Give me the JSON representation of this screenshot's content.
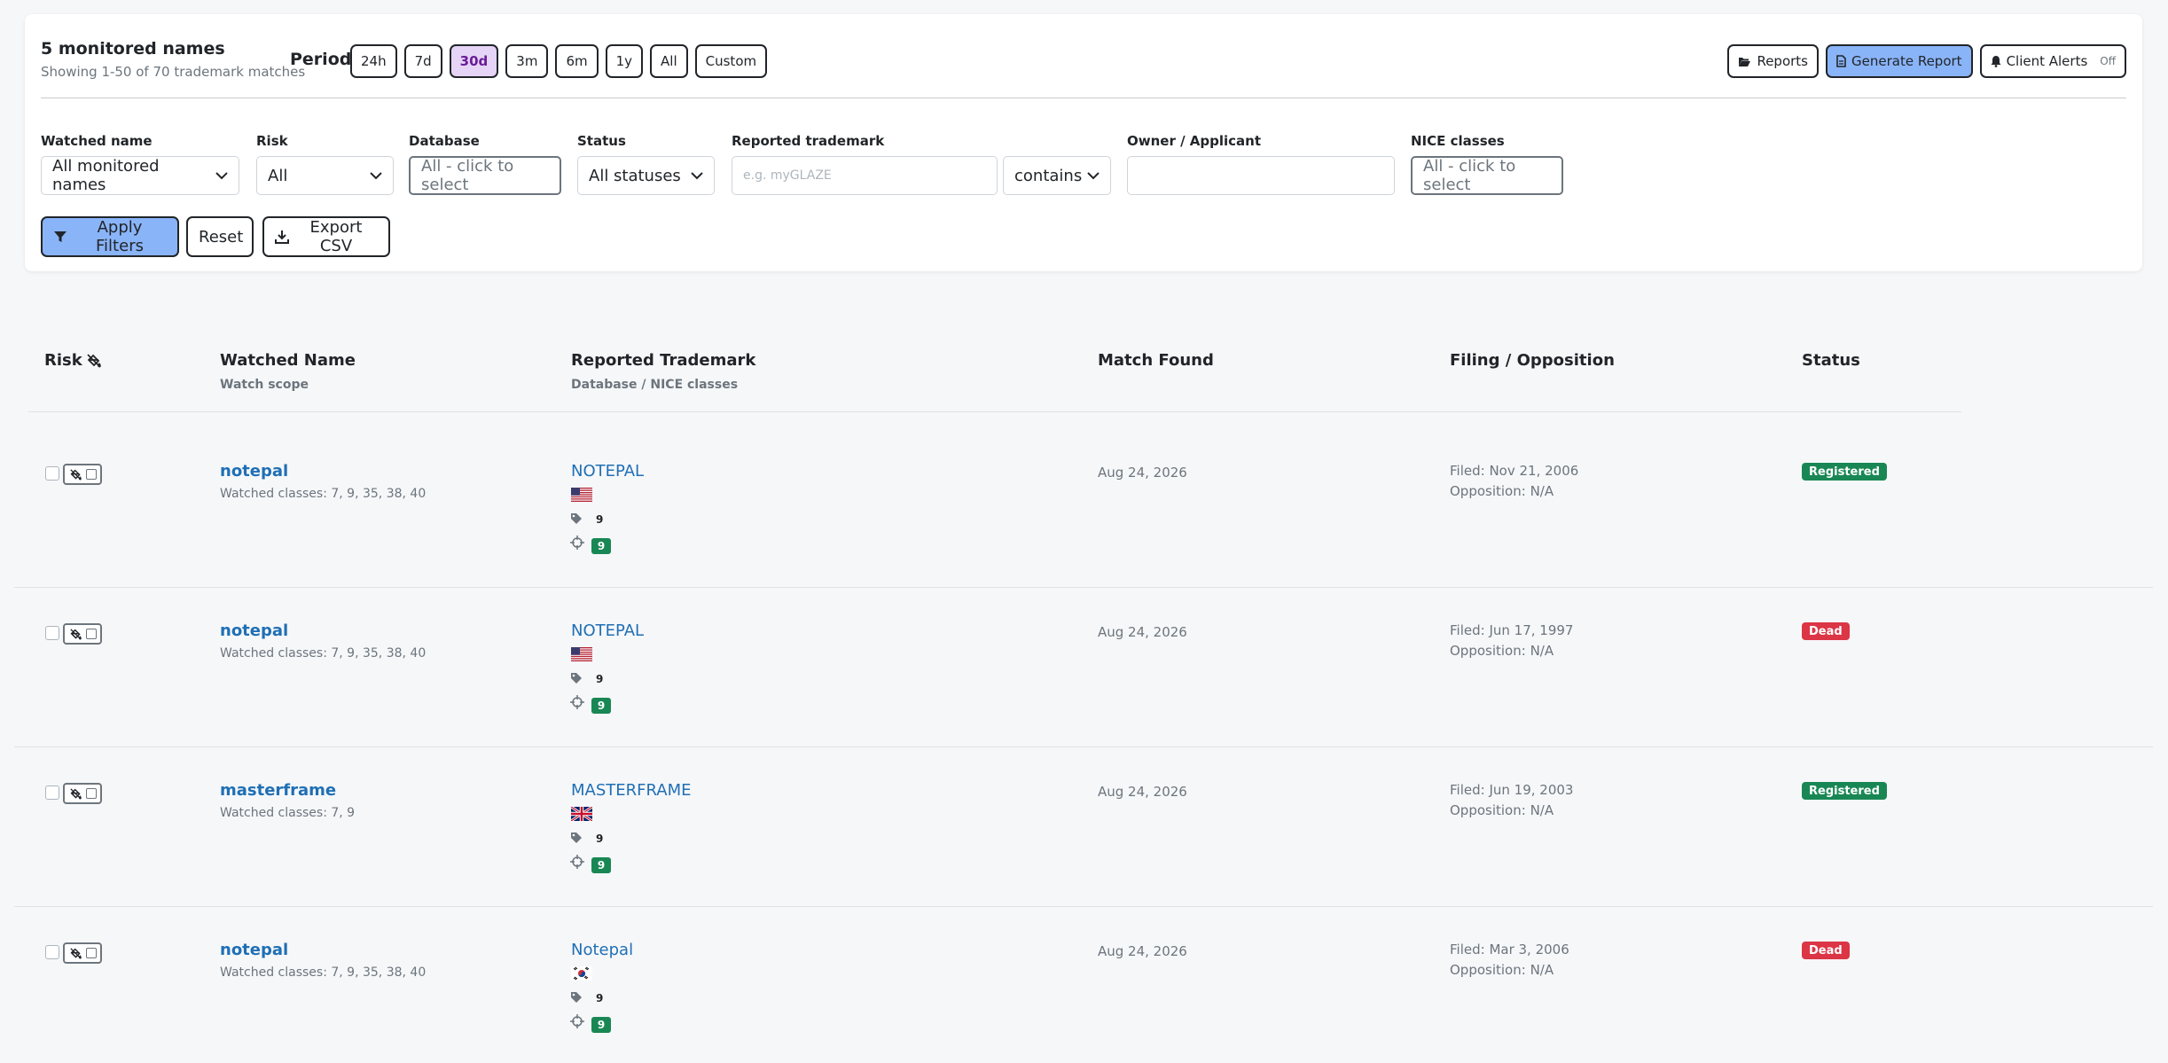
{
  "summary": {
    "title": "5 monitored names",
    "subtitle": "Showing 1-50 of 70 trademark matches"
  },
  "period": {
    "label": "Period",
    "options": [
      "24h",
      "7d",
      "30d",
      "3m",
      "6m",
      "1y",
      "All",
      "Custom"
    ],
    "active": "30d"
  },
  "toolbar": {
    "reports_label": "Reports",
    "generate_label": "Generate Report",
    "alerts_label": "Client Alerts",
    "alerts_state": "Off"
  },
  "filters": {
    "watched_name": {
      "label": "Watched name",
      "value": "All monitored names"
    },
    "risk": {
      "label": "Risk",
      "value": "All"
    },
    "database": {
      "label": "Database",
      "value": "All - click to select"
    },
    "status": {
      "label": "Status",
      "value": "All statuses"
    },
    "reported": {
      "label": "Reported trademark",
      "placeholder": "e.g. myGLAZE",
      "mode": "contains"
    },
    "owner": {
      "label": "Owner / Applicant",
      "value": ""
    },
    "nice": {
      "label": "NICE classes",
      "value": "All - click to select"
    }
  },
  "actions": {
    "apply": "Apply Filters",
    "reset": "Reset",
    "export": "Export CSV"
  },
  "table": {
    "headers": {
      "risk": "Risk",
      "watched": "Watched Name",
      "watched_sub": "Watch scope",
      "reported": "Reported Trademark",
      "reported_sub": "Database / NICE classes",
      "match": "Match Found",
      "filing": "Filing / Opposition",
      "status": "Status"
    },
    "rows": [
      {
        "watched": "notepal",
        "scope": "Watched classes: 7, 9, 35, 38, 40",
        "trademark": "NOTEPAL",
        "flag": "us",
        "tag": "9",
        "nice": "9",
        "match": "Aug 24, 2026",
        "filed": "Filed: Nov 21, 2006",
        "opposition": "Opposition: N/A",
        "status": "Registered",
        "status_color": "#198754"
      },
      {
        "watched": "notepal",
        "scope": "Watched classes: 7, 9, 35, 38, 40",
        "trademark": "NOTEPAL",
        "flag": "us",
        "tag": "9",
        "nice": "9",
        "match": "Aug 24, 2026",
        "filed": "Filed: Jun 17, 1997",
        "opposition": "Opposition: N/A",
        "status": "Dead",
        "status_color": "#dc3545"
      },
      {
        "watched": "masterframe",
        "scope": "Watched classes: 7, 9",
        "trademark": "MASTERFRAME",
        "flag": "uk",
        "tag": "9",
        "nice": "9",
        "match": "Aug 24, 2026",
        "filed": "Filed: Jun 19, 2003",
        "opposition": "Opposition: N/A",
        "status": "Registered",
        "status_color": "#198754"
      },
      {
        "watched": "notepal",
        "scope": "Watched classes: 7, 9, 35, 38, 40",
        "trademark": "Notepal",
        "flag": "kr",
        "tag": "9",
        "nice": "9",
        "match": "Aug 24, 2026",
        "filed": "Filed: Mar 3, 2006",
        "opposition": "Opposition: N/A",
        "status": "Dead",
        "status_color": "#dc3545"
      }
    ]
  }
}
